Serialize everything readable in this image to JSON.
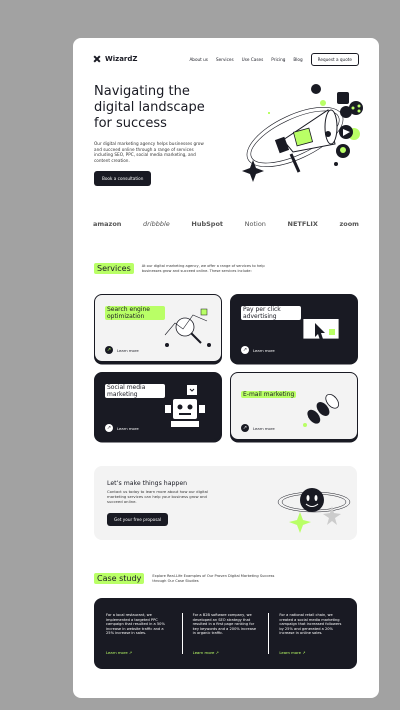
{
  "nav": {
    "brand": "WizardZ",
    "links": [
      "About us",
      "Services",
      "Use Cases",
      "Pricing",
      "Blog"
    ],
    "cta": "Request a quote"
  },
  "hero": {
    "title": "Navigating the digital landscape for success",
    "text": "Our digital marketing agency helps businesses grow and succeed online through a range of services including SEO, PPC, social media marketing, and content creation.",
    "button": "Book a consultation"
  },
  "brands": [
    "amazon",
    "dribbble",
    "HubSpot",
    "Notion",
    "NETFLIX",
    "zoom"
  ],
  "services": {
    "heading": "Services",
    "description": "At our digital marketing agency, we offer a range of services to help businesses grow and succeed online. These services include:",
    "learn_more": "Learn more",
    "cards": [
      {
        "title": "Search engine optimization",
        "variant": "grey",
        "icon": "seo-illustration-icon"
      },
      {
        "title": "Pay per click advertising",
        "variant": "dark",
        "icon": "ppc-illustration-icon"
      },
      {
        "title": "Social media marketing",
        "variant": "dark",
        "icon": "social-illustration-icon"
      },
      {
        "title": "E-mail marketing",
        "variant": "grey",
        "icon": "email-illustration-icon"
      }
    ]
  },
  "cta": {
    "title": "Let’s make things happen",
    "text": "Contact us today to learn more about how our digital marketing services can help your business grow and succeed online.",
    "button": "Get your free proposal"
  },
  "case_study": {
    "heading": "Case study",
    "description": "Explore Real-Life Examples of Our Proven Digital Marketing Success through Our Case Studies",
    "learn_more": "Learn more",
    "items": [
      "For a local restaurant, we implemented a targeted PPC campaign that resulted in a 50% increase in website traffic and a 25% increase in sales.",
      "For a B2B software company, we developed an SEO strategy that resulted in a first page ranking for key keywords and a 200% increase in organic traffic.",
      "For a national retail chain, we created a social media marketing campaign that increased followers by 25% and generated a 20% increase in online sales."
    ]
  },
  "colors": {
    "accent": "#b9ff66",
    "dark": "#191a23",
    "light": "#f3f3f3",
    "backdrop": "#a2a2a2"
  }
}
